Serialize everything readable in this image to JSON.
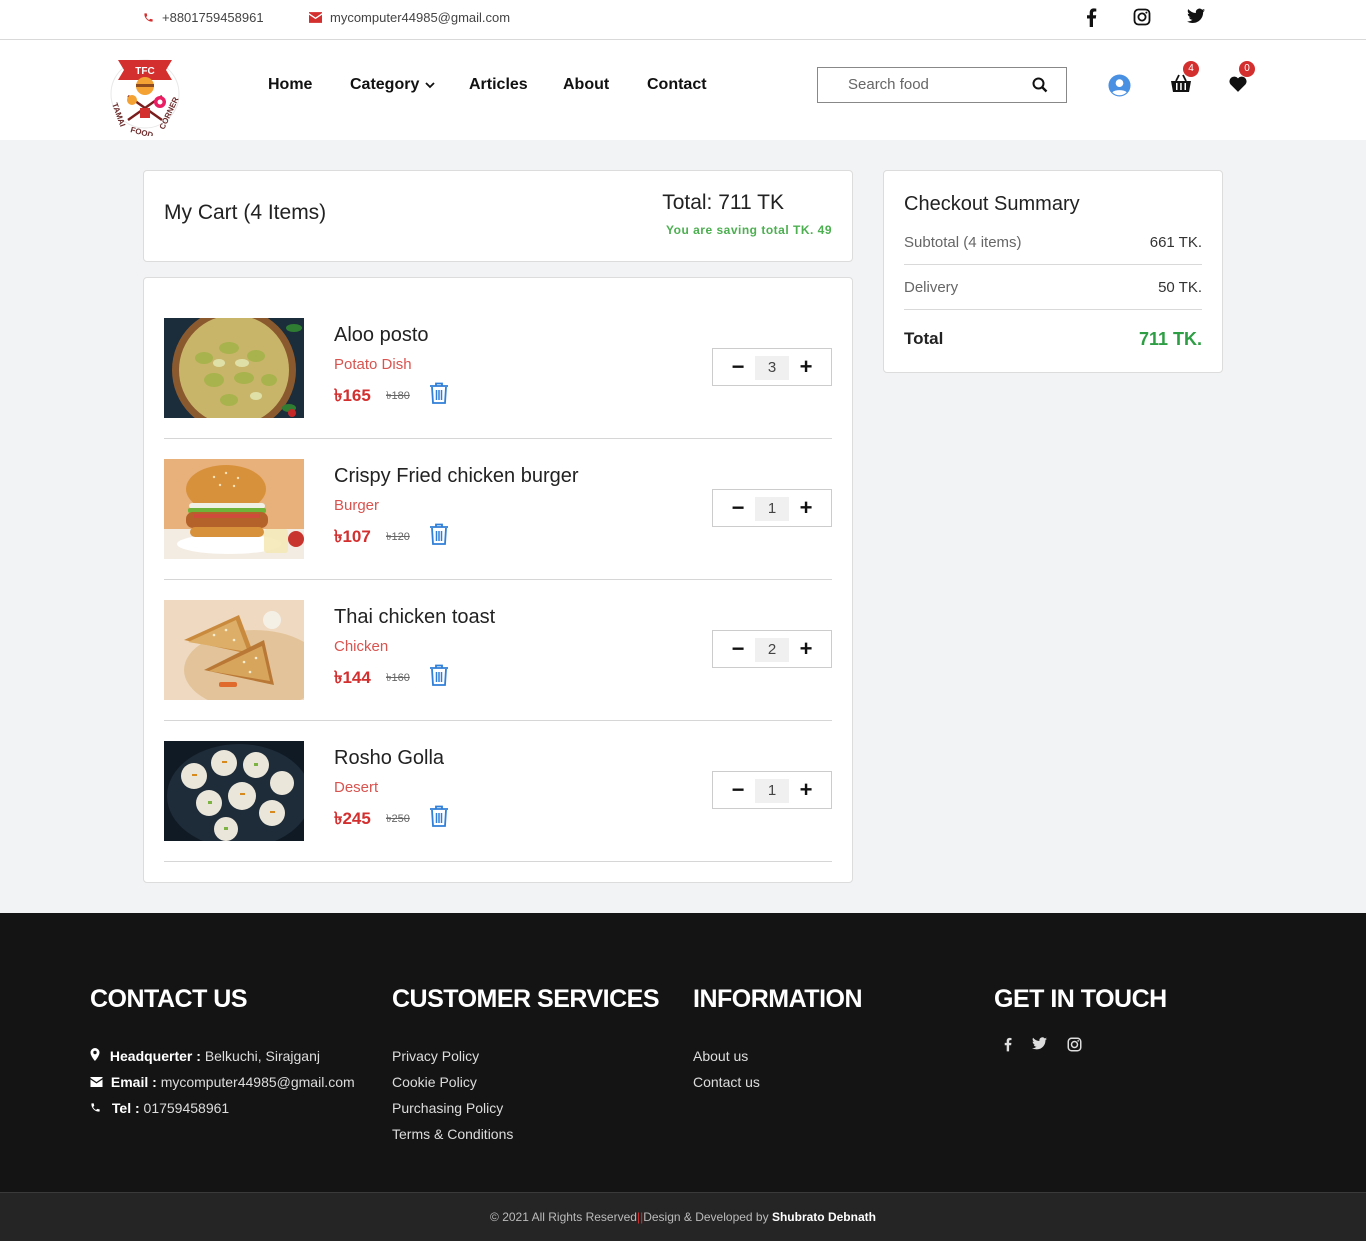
{
  "topbar": {
    "phone": "+8801759458961",
    "email": "mycomputer44985@gmail.com",
    "social": [
      "facebook-icon",
      "instagram-icon",
      "twitter-icon"
    ]
  },
  "header": {
    "logo_text": "TFC",
    "logo_subtext": "TAMAI FOOD CORNER",
    "nav": [
      "Home",
      "Category",
      "Articles",
      "About",
      "Contact"
    ],
    "search_placeholder": "Search food",
    "cart_count": "4",
    "wishlist_count": "0"
  },
  "cart": {
    "title": "My Cart (4 Items)",
    "total": "Total: 711 TK",
    "saving": "You are saving total TK. 49",
    "items": [
      {
        "name": "Aloo posto",
        "category": "Potato Dish",
        "price": "৳165",
        "old_price": "৳180",
        "qty": "3"
      },
      {
        "name": "Crispy Fried chicken burger",
        "category": "Burger",
        "price": "৳107",
        "old_price": "৳120",
        "qty": "1"
      },
      {
        "name": "Thai chicken toast",
        "category": "Chicken",
        "price": "৳144",
        "old_price": "৳160",
        "qty": "2"
      },
      {
        "name": "Rosho Golla",
        "category": "Desert",
        "price": "৳245",
        "old_price": "৳250",
        "qty": "1"
      }
    ]
  },
  "summary": {
    "title": "Checkout Summary",
    "subtotal_label": "Subtotal (4 items)",
    "subtotal_value": "661 TK.",
    "delivery_label": "Delivery",
    "delivery_value": "50 TK.",
    "total_label": "Total",
    "total_value": "711 TK."
  },
  "footer": {
    "contact_title": "CONTACT US",
    "hq_label": "Headquerter :",
    "hq_value": "Belkuchi, Sirajganj",
    "email_label": "Email :",
    "email_value": "mycomputer44985@gmail.com",
    "tel_label": "Tel :",
    "tel_value": "01759458961",
    "services_title": "CUSTOMER SERVICES",
    "services": [
      "Privacy Policy",
      "Cookie Policy",
      "Purchasing Policy",
      "Terms & Conditions"
    ],
    "info_title": "INFORMATION",
    "info": [
      "About us",
      "Contact us"
    ],
    "touch_title": "GET IN TOUCH",
    "copyright": "© 2021 All Rights Reserved",
    "separator": "||",
    "design_text": "Design & Developed by",
    "developer": "Shubrato Debnath"
  },
  "colors": {
    "accent_red": "#d32f2f",
    "saving_green": "#4caf50",
    "total_green": "#2e9e44",
    "footer_bg": "#141414"
  }
}
